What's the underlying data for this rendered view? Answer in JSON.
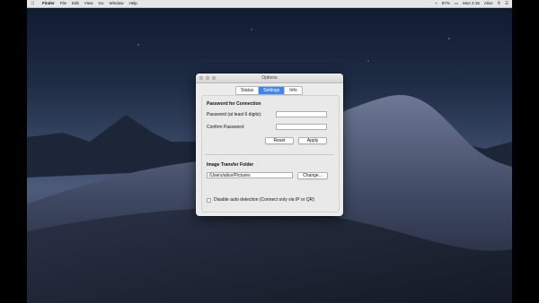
{
  "menubar": {
    "apple_icon": "apple-logo-icon",
    "items": [
      "Finder",
      "File",
      "Edit",
      "View",
      "Go",
      "Window",
      "Help"
    ],
    "status": {
      "battery": "87%",
      "clock": "Mon 2:15",
      "user": "Alice"
    }
  },
  "window": {
    "title": "Options",
    "tabs": [
      {
        "label": "Status",
        "active": false
      },
      {
        "label": "Settings",
        "active": true
      },
      {
        "label": "Info",
        "active": false
      }
    ],
    "password_section": {
      "title": "Password for Connection",
      "password_label": "Password (at least 6 digits):",
      "password_value": "",
      "confirm_label": "Confirm Password:",
      "confirm_value": "",
      "reset_button": "Reset",
      "apply_button": "Apply"
    },
    "folder_section": {
      "title": "Image Transfer Folder",
      "path_value": "/Users/alice/Pictures",
      "change_button": "Change..."
    },
    "auto_detection": {
      "label": "Disable auto detection (Connect only via IP or QR)",
      "checked": false
    }
  },
  "colors": {
    "accent": "#3d86f0",
    "window_bg": "#ececec"
  }
}
